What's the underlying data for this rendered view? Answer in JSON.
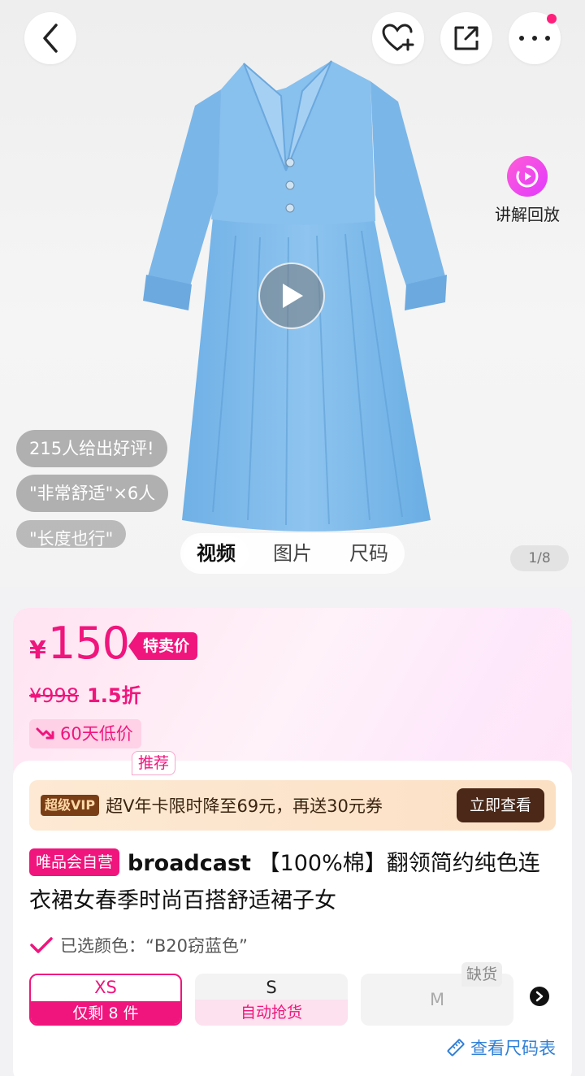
{
  "header": {
    "back_icon": "chevron-left-icon",
    "favorite_icon": "heart-plus-icon",
    "share_icon": "share-icon",
    "more_icon": "more-dots-icon"
  },
  "media": {
    "replay_label": "讲解回放",
    "reviews": [
      "215人给出好评!",
      "\"非常舒适\"×6人",
      "\"长度也行\""
    ],
    "tabs": [
      "视频",
      "图片",
      "尺码"
    ],
    "active_tab": "视频",
    "pager": "1/8"
  },
  "price": {
    "currency": "¥",
    "current": "150",
    "tag": "特卖价",
    "original": "¥998",
    "discount": "1.5折",
    "low_badge": "60天低价"
  },
  "vip": {
    "tag": "超级VIP",
    "text": "超V年卡限时降至69元，再送30元券",
    "button": "立即查看"
  },
  "product": {
    "self_tag": "唯品会自营",
    "brand": "broadcast",
    "title": " 【100%棉】翻领简约纯色连衣裙女春季时尚百搭舒适裙子女",
    "selected_color": "已选颜色：“B20窃蓝色”"
  },
  "sizes": {
    "xs": {
      "label": "XS",
      "sub": "仅剩 8 件",
      "tag": "推荐"
    },
    "s": {
      "label": "S",
      "sub": "自动抢货"
    },
    "m": {
      "label": "M",
      "tag": "缺货"
    },
    "size_chart_link": "查看尺码表"
  },
  "colors": {
    "accent": "#f0157d",
    "vip_dark": "#4b2818",
    "link": "#2f7fd6",
    "dress": "#8fc2ea"
  }
}
